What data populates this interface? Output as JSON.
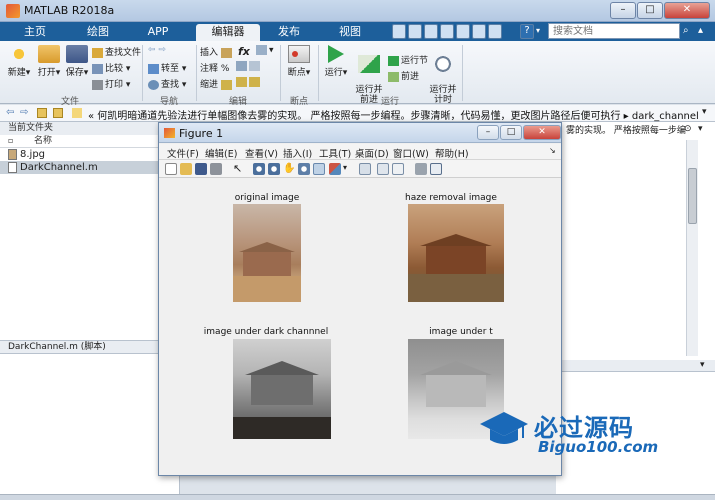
{
  "window": {
    "title": "MATLAB R2018a",
    "min": "–",
    "max": "□",
    "close": "✕"
  },
  "tabs": [
    {
      "label": "主页"
    },
    {
      "label": "绘图"
    },
    {
      "label": "APP"
    },
    {
      "label": "编辑器"
    },
    {
      "label": "发布"
    },
    {
      "label": "视图"
    }
  ],
  "search": {
    "placeholder": "搜索文档"
  },
  "ribbon": {
    "file": {
      "new": "新建",
      "open": "打开",
      "save": "保存",
      "find_files": "查找文件",
      "compare": "比较",
      "print": "打印",
      "group": "文件"
    },
    "nav": {
      "goto": "转至",
      "find": "查找",
      "group": "导航"
    },
    "edit": {
      "insert": "插入",
      "comment": "注释",
      "indent": "缩进",
      "fx": "fx",
      "percent": "%",
      "group": "编辑"
    },
    "breakpoints": {
      "bp": "断点",
      "group": "断点"
    },
    "run": {
      "run": "运行",
      "run_advance": "运行并\n前进",
      "run_section": "运行节",
      "advance": "前进",
      "run_time": "运行并\n计时",
      "group": "运行"
    }
  },
  "address": {
    "path": "«  何凯明暗通道先验法进行单幅图像去雾的实现。 严格按照每一步编程。步骤清晰，代码易懂，更改图片路径后便可执行  ▸  dark_channel_matlab"
  },
  "left_panel": {
    "header": "当前文件夹",
    "column": "名称",
    "files": [
      {
        "name": "8.jpg"
      },
      {
        "name": "DarkChannel.m"
      }
    ],
    "details": "DarkChannel.m  (脚本)"
  },
  "right_panel": {
    "line": "雾的实现。 严格按照每一步编..."
  },
  "figure": {
    "title": "Figure 1",
    "menu": [
      {
        "label": "文件(F)"
      },
      {
        "label": "编辑(E)"
      },
      {
        "label": "查看(V)"
      },
      {
        "label": "插入(I)"
      },
      {
        "label": "工具(T)"
      },
      {
        "label": "桌面(D)"
      },
      {
        "label": "窗口(W)"
      },
      {
        "label": "帮助(H)"
      }
    ],
    "subplots": [
      {
        "title": "original image"
      },
      {
        "title": "haze removal image"
      },
      {
        "title": "image under dark channnel"
      },
      {
        "title": "image under t"
      }
    ]
  },
  "watermark": {
    "text": "必过源码",
    "url": "Biguo100.com"
  },
  "colors": {
    "accent": "#1d5f9b",
    "watermark": "#1a69b8"
  }
}
